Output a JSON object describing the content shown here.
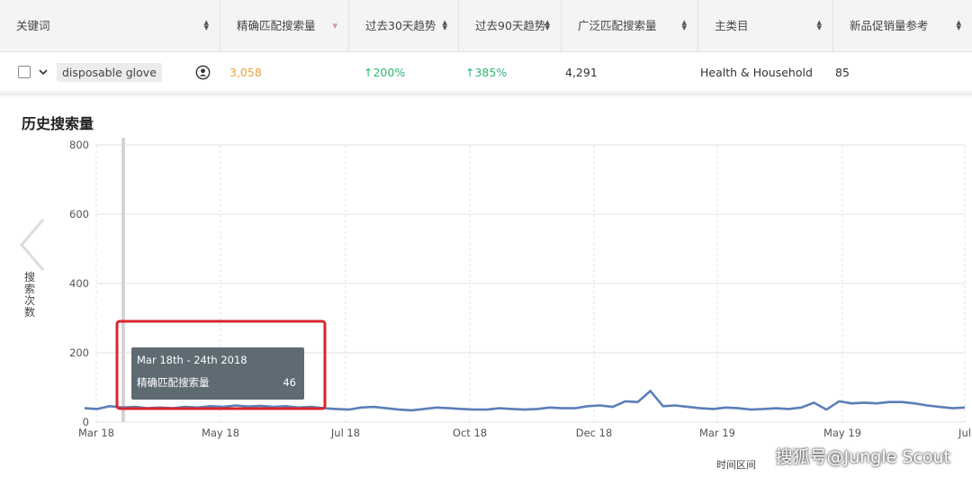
{
  "table": {
    "headers": [
      {
        "label": "关键词"
      },
      {
        "label": "精确匹配搜索量"
      },
      {
        "label": "过去30天趋势"
      },
      {
        "label": "过去90天趋势"
      },
      {
        "label": "广泛匹配搜索量"
      },
      {
        "label": "主类目"
      },
      {
        "label": "新品促销量参考"
      }
    ],
    "row": {
      "keyword": "disposable glove",
      "exact_volume": "3,058",
      "trend_30": "↑200%",
      "trend_90": "↑385%",
      "broad_volume": "4,291",
      "category": "Health & Household",
      "promo": "85"
    }
  },
  "chart_section": {
    "title": "历史搜索量",
    "ylabel": "搜索次数",
    "xlabel": "时间区间",
    "watermark": "搜狐号@Jungle Scout",
    "colors": {
      "line": "#5b7fb8",
      "tooltip_bg": "#5f6b73",
      "highlight": "#d9262b",
      "grid": "#e3e3e3"
    }
  },
  "tooltip": {
    "date": "Mar 18th - 24th 2018",
    "series_label": "精确匹配搜索量",
    "value": "46"
  },
  "chart_data": {
    "type": "line",
    "ylim": [
      0,
      800
    ],
    "yticks": [
      0,
      200,
      400,
      600,
      800
    ],
    "xticks": [
      "Mar 18",
      "May 18",
      "Jul 18",
      "Oct 18",
      "Dec 18",
      "Mar 19",
      "May 19",
      "Jul"
    ],
    "grid": true,
    "x": [
      "2018-03-04",
      "2018-03-11",
      "2018-03-18",
      "2018-03-25",
      "2018-04-01",
      "2018-04-08",
      "2018-04-15",
      "2018-04-22",
      "2018-04-29",
      "2018-05-06",
      "2018-05-13",
      "2018-05-20",
      "2018-05-27",
      "2018-06-03",
      "2018-06-10",
      "2018-06-17",
      "2018-06-24",
      "2018-07-01",
      "2018-07-08",
      "2018-07-15",
      "2018-07-22",
      "2018-07-29",
      "2018-08-05",
      "2018-08-12",
      "2018-08-19",
      "2018-08-26",
      "2018-09-02",
      "2018-09-09",
      "2018-09-16",
      "2018-09-23",
      "2018-09-30",
      "2018-10-07",
      "2018-10-14",
      "2018-10-21",
      "2018-10-28",
      "2018-11-04",
      "2018-11-11",
      "2018-11-18",
      "2018-11-25",
      "2018-12-02",
      "2018-12-09",
      "2018-12-16",
      "2018-12-23",
      "2018-12-30",
      "2019-01-06",
      "2019-01-13",
      "2019-01-20",
      "2019-01-27",
      "2019-02-03",
      "2019-02-10",
      "2019-02-17",
      "2019-02-24",
      "2019-03-03",
      "2019-03-10",
      "2019-03-17",
      "2019-03-24",
      "2019-03-31",
      "2019-04-07",
      "2019-04-14",
      "2019-04-21",
      "2019-04-28",
      "2019-05-05",
      "2019-05-12",
      "2019-05-19",
      "2019-05-26",
      "2019-06-02",
      "2019-06-09",
      "2019-06-16",
      "2019-06-23",
      "2019-06-30",
      "2019-07-07"
    ],
    "series": [
      {
        "values": [
          40,
          38,
          46,
          42,
          44,
          40,
          42,
          40,
          44,
          42,
          46,
          44,
          48,
          45,
          47,
          44,
          46,
          42,
          44,
          40,
          38,
          36,
          42,
          44,
          40,
          36,
          34,
          38,
          42,
          40,
          38,
          36,
          36,
          40,
          38,
          36,
          38,
          42,
          40,
          40,
          46,
          48,
          44,
          60,
          58,
          90,
          46,
          48,
          44,
          40,
          38,
          42,
          40,
          36,
          38,
          40,
          38,
          42,
          56,
          36,
          60,
          54,
          56,
          54,
          58,
          58,
          54,
          48,
          44,
          40,
          42
        ]
      }
    ]
  }
}
